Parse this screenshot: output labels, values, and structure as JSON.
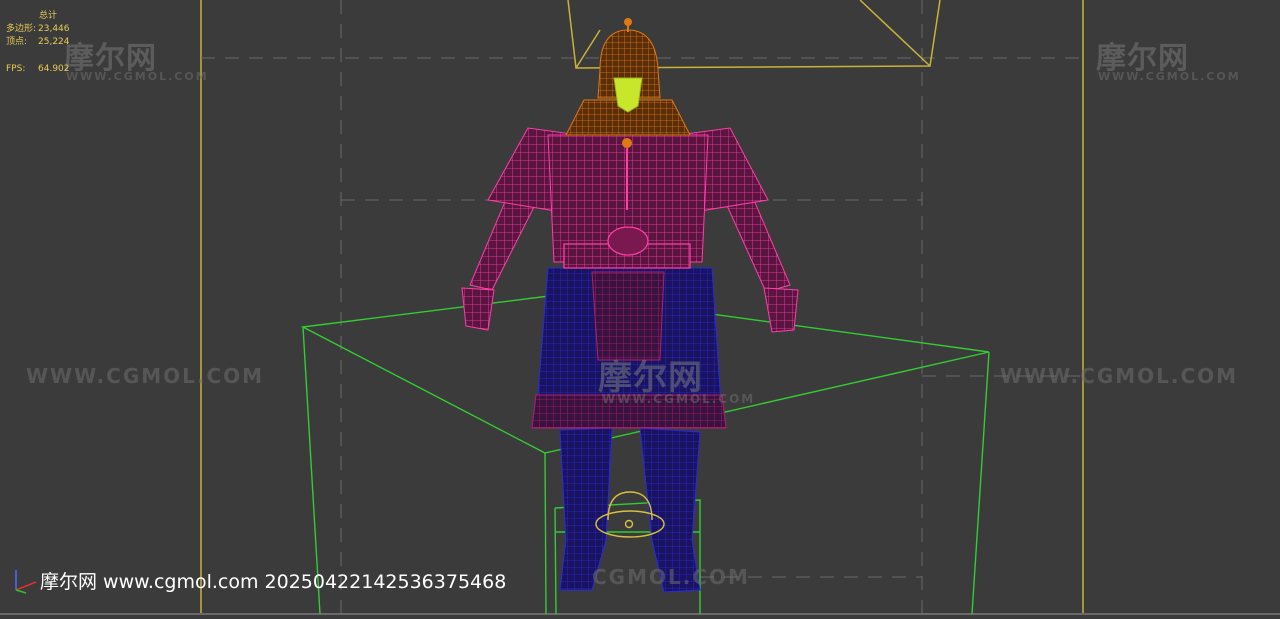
{
  "stats": {
    "header": "总计",
    "polygons_label": "多边形:",
    "polygons_value": "23,446",
    "vertices_label": "顶点:",
    "vertices_value": "25,224",
    "fps_label": "FPS:",
    "fps_value": "64.902"
  },
  "watermarks": {
    "brand_cn": "摩尔网",
    "brand_url_small": "WWW.CGMOL.COM",
    "brand_url_large": "WWW.CGMOL.COM",
    "brand_url_bottom": "CGMOL.COM"
  },
  "footer": {
    "caption": "摩尔网 www.cgmol.com 20250422142536375468"
  },
  "colors": {
    "background": "#3b3b3b",
    "frame_yellow": "#c9b23a",
    "box_green": "#33cc33",
    "wire_pink": "#ff3fa8",
    "wire_orange": "#e07a10",
    "wire_blue": "#2a2ad8",
    "wire_lime": "#c8e62a",
    "stats_text": "#e8cc55"
  }
}
